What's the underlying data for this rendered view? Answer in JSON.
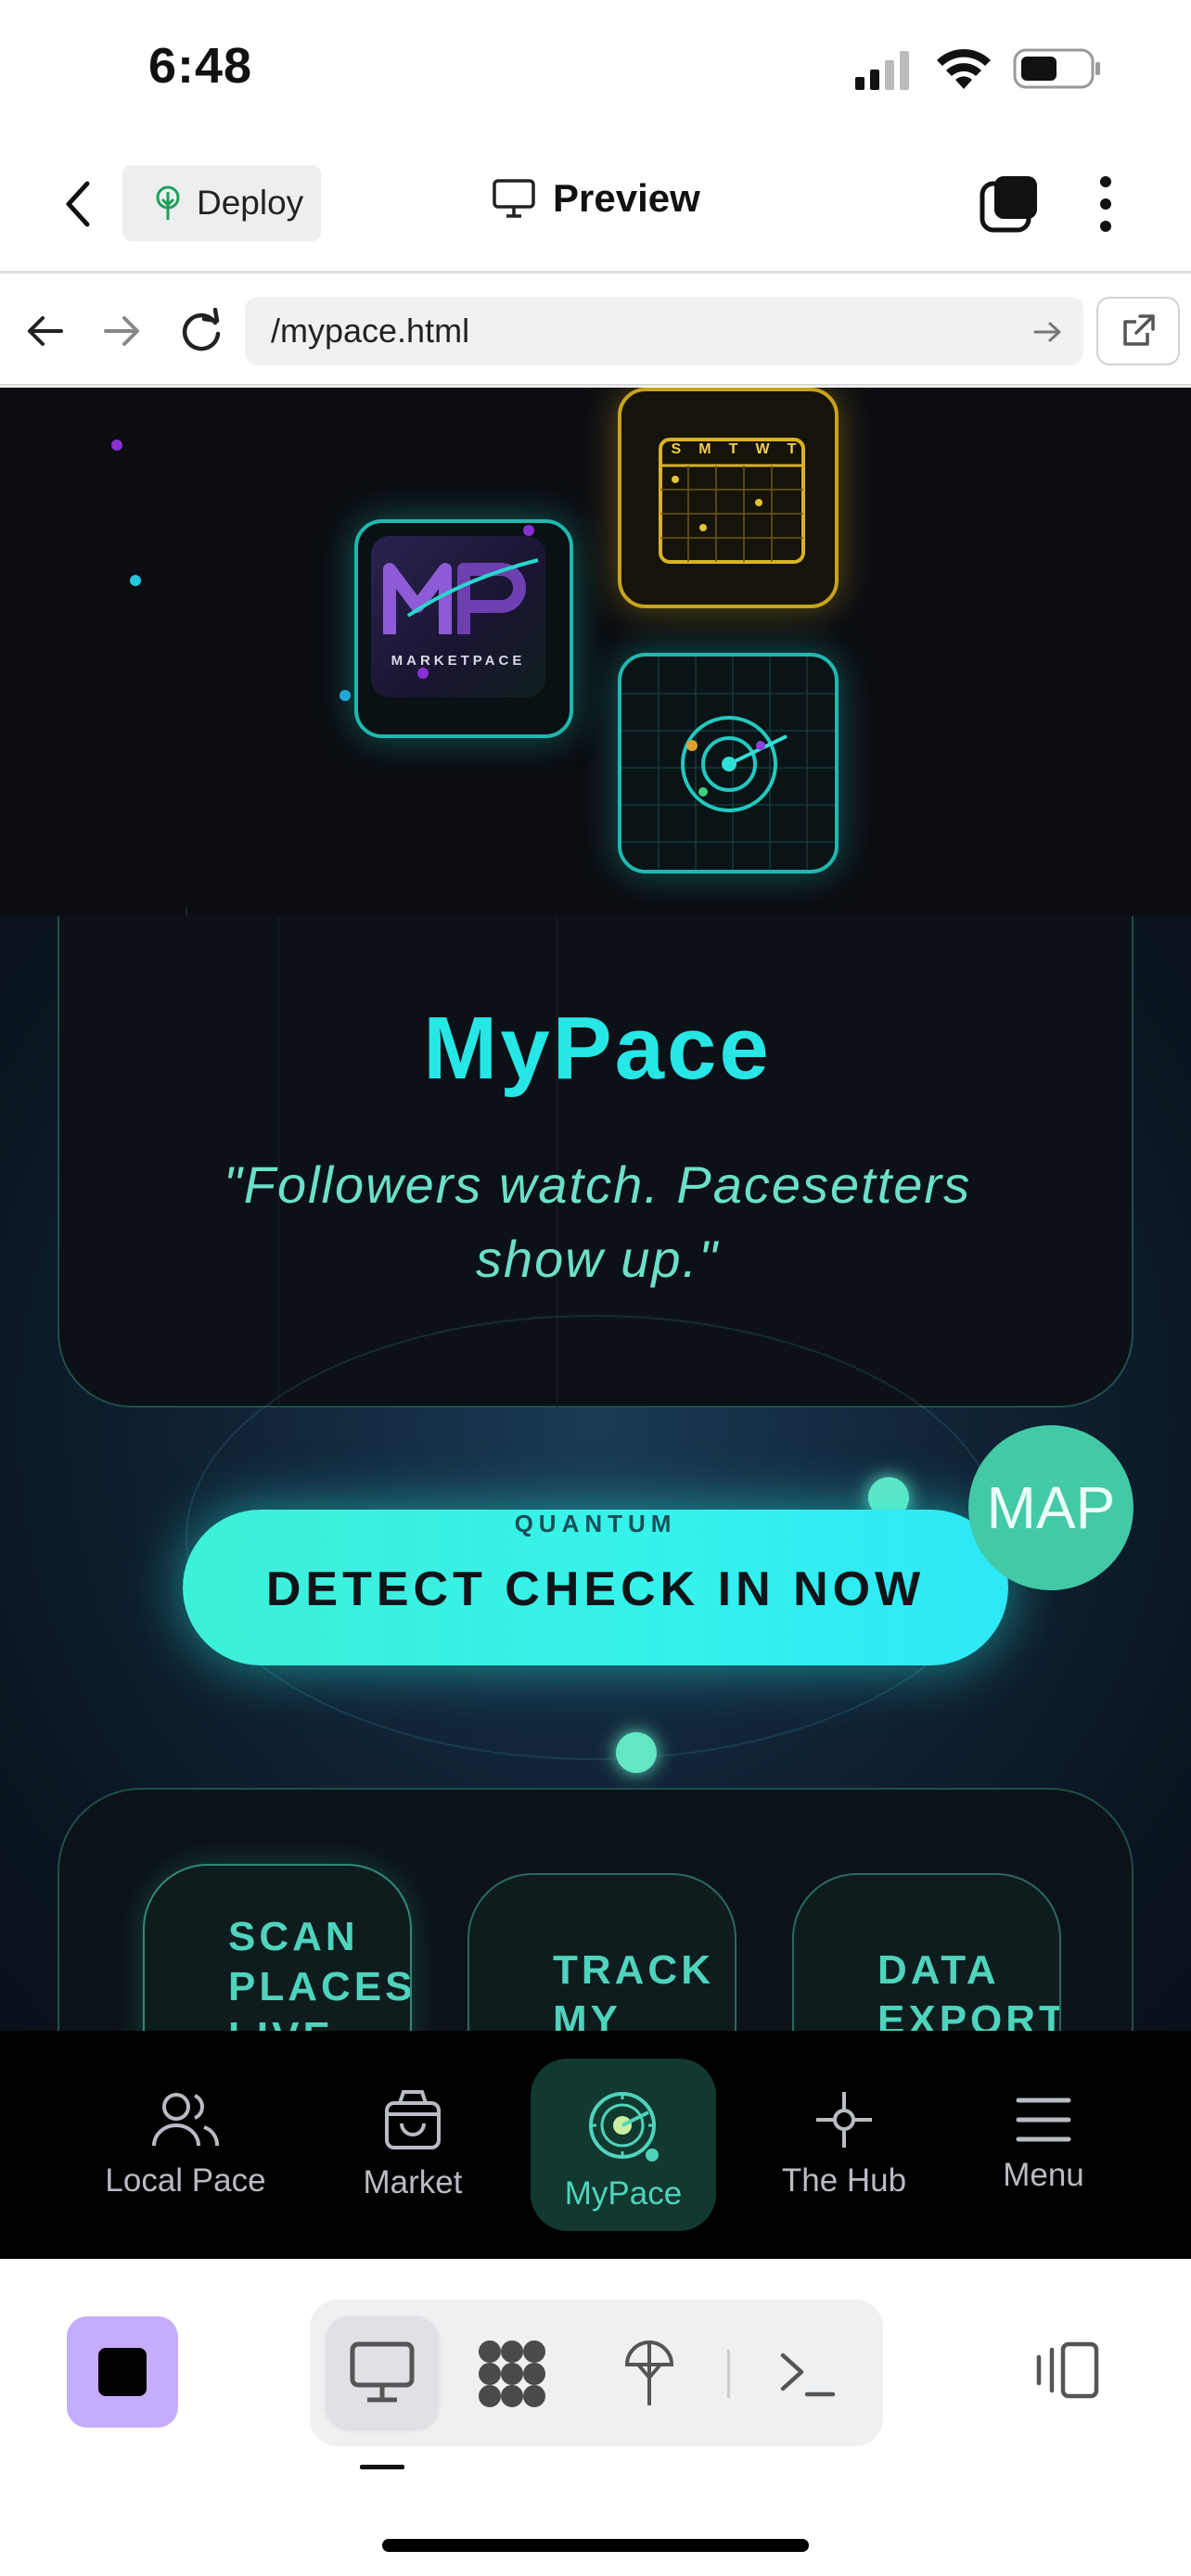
{
  "status_bar": {
    "time": "6:48"
  },
  "app_header": {
    "deploy_label": "Deploy",
    "preview_label": "Preview"
  },
  "browser": {
    "url": "/mypace.html"
  },
  "hero": {
    "logo_text": "MARKETPACE",
    "calendar_days": [
      "S",
      "M",
      "T",
      "W",
      "T"
    ]
  },
  "main": {
    "title": "MyPace",
    "tagline": "\"Followers watch. Pacesetters show up.\"",
    "cta": {
      "sub_label": "QUANTUM",
      "label": "DETECT CHECK IN NOW"
    },
    "features": [
      {
        "label": "SCAN PLACES LIVE"
      },
      {
        "label": "TRACK MY"
      },
      {
        "label": "DATA EXPORT"
      }
    ],
    "map_fab": "MAP"
  },
  "tabs": [
    {
      "label": "Local Pace",
      "icon": "users-icon"
    },
    {
      "label": "Market",
      "icon": "shopping-bag-icon"
    },
    {
      "label": "MyPace",
      "icon": "radar-icon",
      "active": true
    },
    {
      "label": "The Hub",
      "icon": "hub-node-icon"
    },
    {
      "label": "Menu",
      "icon": "hamburger-icon"
    }
  ],
  "colors": {
    "accent": "#27e6e6",
    "accent_green": "#4fd3bc",
    "background": "#0b1017",
    "stop_button": "#c4aefc"
  }
}
